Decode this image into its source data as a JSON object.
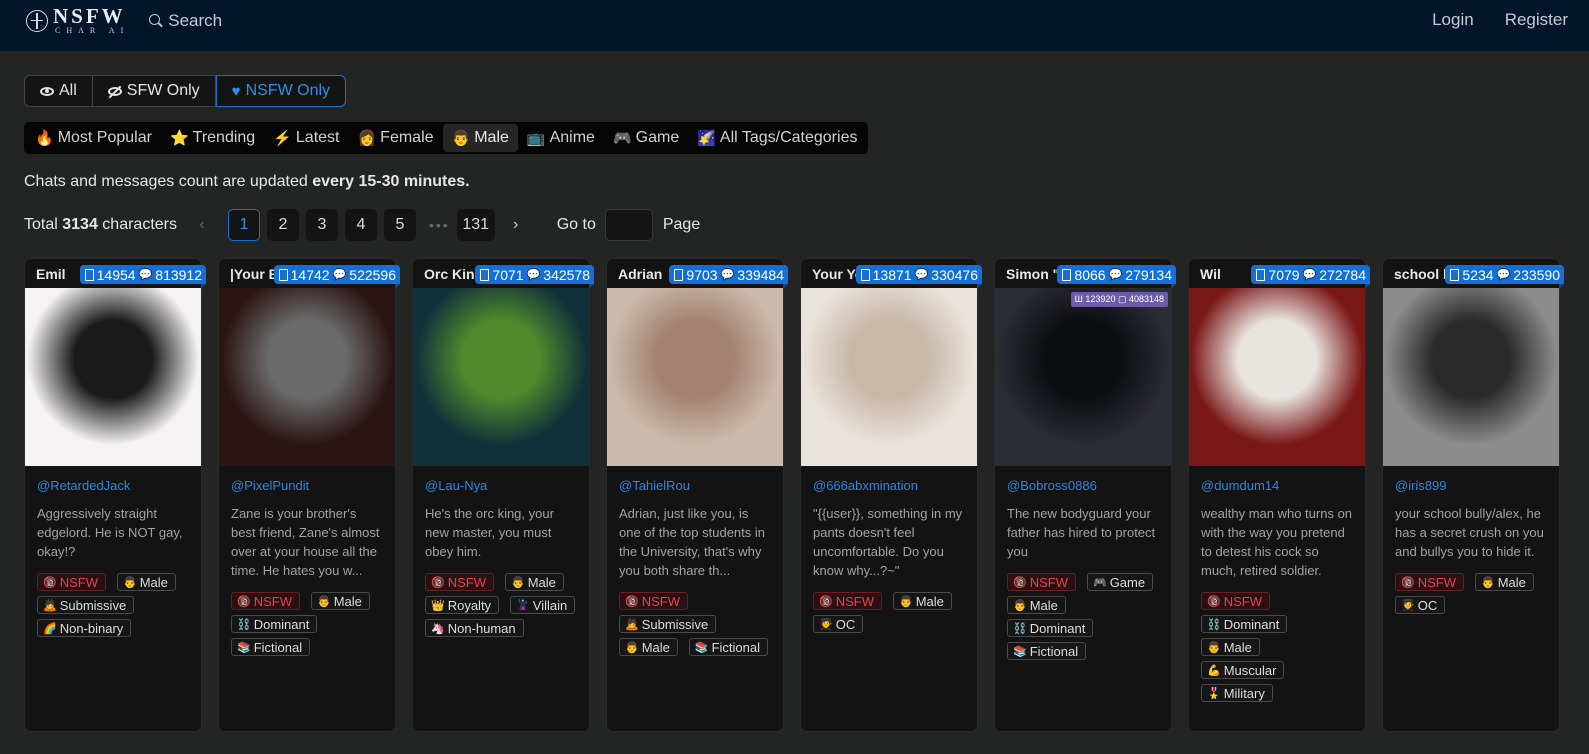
{
  "header": {
    "logo_main": "NSFW",
    "logo_sub": "CHAR AI",
    "search_label": "Search",
    "login_label": "Login",
    "register_label": "Register"
  },
  "filter": {
    "options": [
      {
        "label": "All",
        "icon": "eye-icon",
        "active": false
      },
      {
        "label": "SFW Only",
        "icon": "eye-slash-icon",
        "active": false
      },
      {
        "label": "NSFW Only",
        "icon": "heart-icon",
        "active": true
      }
    ]
  },
  "categories": [
    {
      "emoji": "🔥",
      "label": "Most Popular",
      "active": false
    },
    {
      "emoji": "⭐",
      "label": "Trending",
      "active": false
    },
    {
      "emoji": "⚡",
      "label": "Latest",
      "active": false
    },
    {
      "emoji": "👩",
      "label": "Female",
      "active": false
    },
    {
      "emoji": "👨",
      "label": "Male",
      "active": true
    },
    {
      "emoji": "📺",
      "label": "Anime",
      "active": false
    },
    {
      "emoji": "🎮",
      "label": "Game",
      "active": false
    },
    {
      "emoji": "🌠",
      "label": "All Tags/Categories",
      "active": false
    }
  ],
  "notice": {
    "prefix": "Chats and messages count are updated ",
    "bold": "every 15-30 minutes."
  },
  "pagination": {
    "total_prefix": "Total ",
    "total_count": "3134",
    "total_suffix": " characters",
    "pages": [
      "1",
      "2",
      "3",
      "4",
      "5"
    ],
    "current": "1",
    "ellipsis": "•••",
    "last_page": "131",
    "prev": "‹",
    "next": "›",
    "goto_label": "Go to",
    "goto_value": "",
    "page_label": "Page"
  },
  "cards": [
    {
      "name": "Emil",
      "chats": "14954",
      "messages": "813912",
      "handle": "@RetardedJack",
      "desc": "Aggressively straight edgelord. He is NOT gay, okay!?",
      "tags": [
        {
          "emoji": "🔞",
          "label": "NSFW",
          "nsfw": true
        },
        {
          "emoji": "👨",
          "label": "Male"
        },
        {
          "emoji": "🙇",
          "label": "Submissive"
        },
        {
          "emoji": "🌈",
          "label": "Non-binary"
        }
      ],
      "img_colors": [
        "#f4f2f2",
        "#1a1a1a"
      ]
    },
    {
      "name": "|Your Brother's Best Friend|",
      "chats": "14742",
      "messages": "522596",
      "handle": "@PixelPundit",
      "desc": "Zane is your brother's best friend, Zane's almost over at your house all the time. He hates you w...",
      "tags": [
        {
          "emoji": "🔞",
          "label": "NSFW",
          "nsfw": true
        },
        {
          "emoji": "👨",
          "label": "Male"
        },
        {
          "emoji": "⛓️",
          "label": "Dominant"
        },
        {
          "emoji": "📚",
          "label": "Fictional"
        }
      ],
      "img_colors": [
        "#2b1414",
        "#6a6a6a"
      ]
    },
    {
      "name": "Orc King",
      "chats": "7071",
      "messages": "342578",
      "handle": "@Lau-Nya",
      "desc": "He's the orc king, your new master, you must obey him.",
      "tags": [
        {
          "emoji": "🔞",
          "label": "NSFW",
          "nsfw": true
        },
        {
          "emoji": "👨",
          "label": "Male"
        },
        {
          "emoji": "👑",
          "label": "Royalty"
        },
        {
          "emoji": "🦹",
          "label": "Villain"
        },
        {
          "emoji": "🦄",
          "label": "Non-human"
        }
      ],
      "img_colors": [
        "#12303a",
        "#4d8a2c"
      ]
    },
    {
      "name": "Adrian",
      "chats": "9703",
      "messages": "339484",
      "handle": "@TahielRou",
      "desc": "Adrian, just like you, is one of the top students in the University, that's why you both share th...",
      "tags": [
        {
          "emoji": "🔞",
          "label": "NSFW",
          "nsfw": true
        },
        {
          "emoji": "🙇",
          "label": "Submissive"
        },
        {
          "emoji": "👨",
          "label": "Male"
        },
        {
          "emoji": "📚",
          "label": "Fictional"
        }
      ],
      "img_colors": [
        "#cbb9ab",
        "#a3836f"
      ]
    },
    {
      "name": "Your Younger Brother",
      "chats": "13871",
      "messages": "330476",
      "handle": "@666abxmination",
      "desc": "\"{{user}}, something in my pants doesn't feel uncomfortable. Do you know why...?~\"",
      "tags": [
        {
          "emoji": "🔞",
          "label": "NSFW",
          "nsfw": true
        },
        {
          "emoji": "👨",
          "label": "Male"
        },
        {
          "emoji": "🧑‍🎓",
          "label": "OC"
        }
      ],
      "img_colors": [
        "#e8e3dc",
        "#c8b8a8"
      ]
    },
    {
      "name": "Simon \"Ghost\" Riley",
      "chats": "8066",
      "messages": "279134",
      "handle": "@Bobross0886",
      "desc": "The new bodyguard your father has hired to protect you",
      "tags": [
        {
          "emoji": "🔞",
          "label": "NSFW",
          "nsfw": true
        },
        {
          "emoji": "🎮",
          "label": "Game"
        },
        {
          "emoji": "👨",
          "label": "Male"
        },
        {
          "emoji": "⛓️",
          "label": "Dominant"
        },
        {
          "emoji": "📚",
          "label": "Fictional"
        }
      ],
      "img_colors": [
        "#2a2c33",
        "#0d0e12"
      ],
      "inner_badge": "Ш 123920 ▢ 4083148"
    },
    {
      "name": "Wil",
      "chats": "7079",
      "messages": "272784",
      "handle": "@dumdum14",
      "desc": "wealthy man who turns on with the way you pretend to detest his cock so much, retired soldier.",
      "tags": [
        {
          "emoji": "🔞",
          "label": "NSFW",
          "nsfw": true
        },
        {
          "emoji": "⛓️",
          "label": "Dominant"
        },
        {
          "emoji": "👨",
          "label": "Male"
        },
        {
          "emoji": "💪",
          "label": "Muscular"
        },
        {
          "emoji": "🎖️",
          "label": "Military"
        }
      ],
      "img_colors": [
        "#7a1818",
        "#e8e4df"
      ]
    },
    {
      "name": "school bully",
      "chats": "5234",
      "messages": "233590",
      "handle": "@iris899",
      "desc": "your school bully/alex, he has a secret crush on you and bullys you to hide it.",
      "tags": [
        {
          "emoji": "🔞",
          "label": "NSFW",
          "nsfw": true
        },
        {
          "emoji": "👨",
          "label": "Male"
        },
        {
          "emoji": "🧑‍🎓",
          "label": "OC"
        }
      ],
      "img_colors": [
        "#8c8c8c",
        "#2a2a2a"
      ]
    }
  ]
}
